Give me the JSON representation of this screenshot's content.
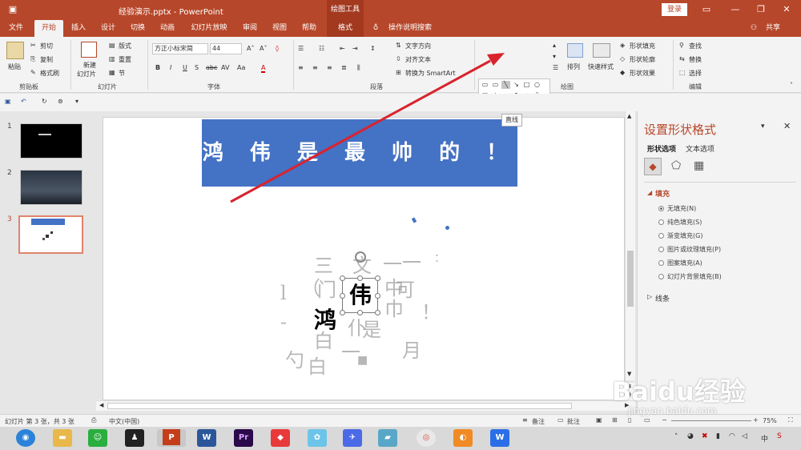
{
  "window": {
    "title": "经验演示.pptx  -  PowerPoint",
    "context_tab": "绘图工具",
    "login": "登录",
    "share": "共享"
  },
  "tabs": [
    "文件",
    "开始",
    "插入",
    "设计",
    "切换",
    "动画",
    "幻灯片放映",
    "审阅",
    "视图",
    "帮助",
    "格式"
  ],
  "tell_me": "操作说明搜索",
  "ribbon": {
    "paste": "粘贴",
    "cut": "剪切",
    "copy": "复制",
    "format_painter": "格式刷",
    "clipboard_label": "剪贴板",
    "new_slide": "新建",
    "new_slide2": "幻灯片",
    "layout": "版式",
    "reset": "重置",
    "section": "节",
    "slides_label": "幻灯片",
    "font_name": "方正小标宋简",
    "font_size": "44",
    "font_label": "字体",
    "text_direction": "文字方向",
    "align_text": "对齐文本",
    "convert_smartart": "转换为 SmartArt",
    "paragraph_label": "段落",
    "arrange": "排列",
    "quick_styles": "快速样式",
    "shape_fill": "形状填充",
    "shape_outline": "形状轮廓",
    "shape_effects": "形状效果",
    "drawing_label": "绘图",
    "find": "查找",
    "replace": "替换",
    "select": "选择",
    "editing_label": "编辑"
  },
  "tooltip": "直线",
  "slides": [
    {
      "num": "1"
    },
    {
      "num": "2"
    },
    {
      "num": "3"
    }
  ],
  "slide": {
    "banner_text": "鸿 伟 是 最 帅 的 ！",
    "char_hong": "鸿",
    "char_wei": "伟"
  },
  "pane": {
    "title": "设置形状格式",
    "tab_shape": "形状选项",
    "tab_text": "文本选项",
    "fill_section": "填充",
    "fill_options": [
      "无填充(N)",
      "纯色填充(S)",
      "渐变填充(G)",
      "图片或纹理填充(P)",
      "图案填充(A)",
      "幻灯片背景填充(B)"
    ],
    "line_section": "线条"
  },
  "status": {
    "slide_info": "幻灯片 第 3 张，共 3 张",
    "language": "中文(中国)",
    "notes": "备注",
    "comments": "批注",
    "zoom": "75%"
  },
  "taskbar": {
    "time": "中"
  },
  "watermark": {
    "brand": "Baidu经验",
    "url": "jingyan.baidu.com"
  },
  "colors": {
    "accent": "#b7472a",
    "banner": "#4472c4",
    "arrow": "#d9232d"
  }
}
